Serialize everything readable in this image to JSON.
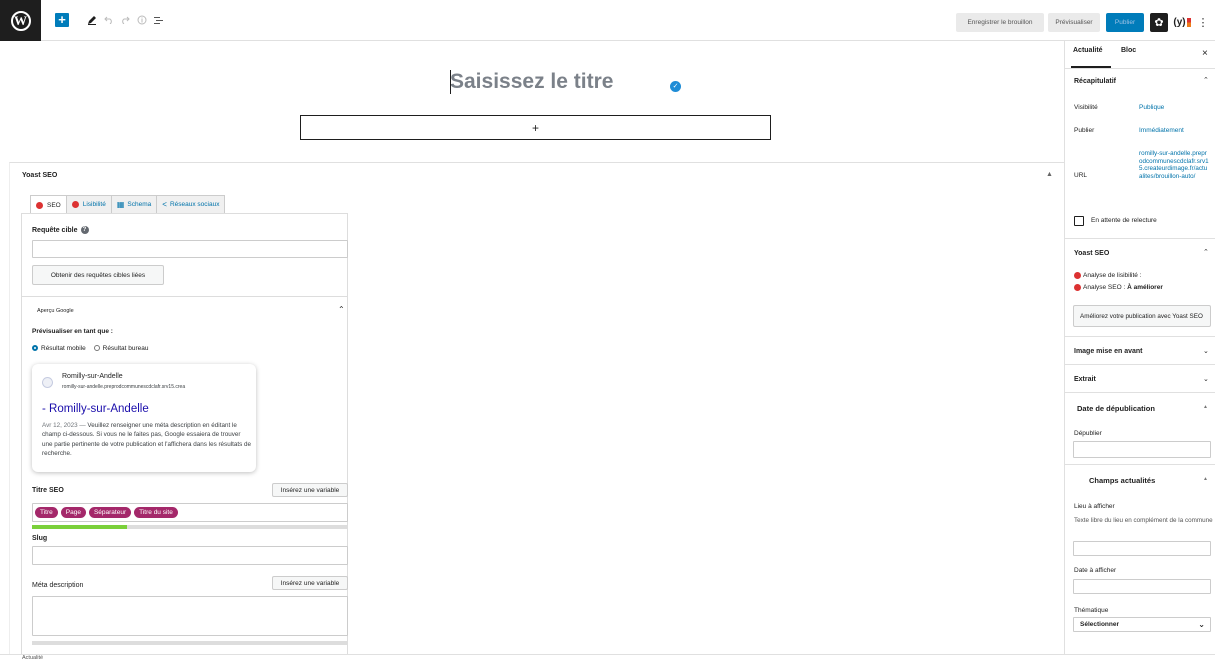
{
  "toolbar": {
    "wp_logo": "W",
    "add_glyph": "+",
    "save_draft": "Enregistrer le brouillon",
    "preview": "Prévisualiser",
    "publish": "Publier",
    "yoast_glyph": "(y)",
    "more_glyph": "⋮",
    "icons": [
      "wordpress-icon",
      "plus-icon",
      "pencil-icon",
      "undo-icon",
      "redo-icon",
      "info-icon",
      "list-view-icon",
      "gear-icon",
      "yoast-icon",
      "more-icon"
    ]
  },
  "editor": {
    "title_placeholder": "Saisissez le titre",
    "appender_glyph": "+"
  },
  "yoast": {
    "title": "Yoast SEO",
    "tabs": [
      {
        "label": "SEO",
        "icon": "red-dot-icon"
      },
      {
        "label": "Lisibilité",
        "icon": "red-dot-icon"
      },
      {
        "label": "Schema",
        "icon": "grid-icon"
      },
      {
        "label": "Réseaux sociaux",
        "icon": "share-icon"
      }
    ],
    "keyphrase_label": "Requête cible",
    "keyphrase_value": "",
    "related_button": "Obtenir des requêtes cibles liées",
    "google_preview_label": "Aperçu Google",
    "preview_as_label": "Prévisualiser en tant que :",
    "mode_mobile": "Résultat mobile",
    "mode_desktop": "Résultat bureau",
    "mode_selected": "mobile",
    "snippet": {
      "site_name": "Romilly-sur-Andelle",
      "site_url": "romilly-sur-andelle.preprodcommunescdclafr.srv15.crea",
      "title": "- Romilly-sur-Andelle",
      "date": "Avr 12, 2023",
      "dash": "—",
      "description": "Veuillez renseigner une méta description en éditant le champ ci-dessous. Si vous ne le faites pas, Google essaiera de trouver une partie pertinente de votre publication et l'affichera dans les résultats de recherche."
    },
    "seo_title_label": "Titre SEO",
    "insert_variable": "Insérez une variable",
    "title_pills": [
      "Titre",
      "Page",
      "Séparateur",
      "Titre du site"
    ],
    "title_progress": 0.3,
    "slug_label": "Slug",
    "slug_value": "",
    "meta_label": "Méta description",
    "meta_value": ""
  },
  "sidebar": {
    "tab_post": "Actualité",
    "tab_block": "Bloc",
    "close_glyph": "×",
    "summary_title": "Récapitulatif",
    "visibility_label": "Visibilité",
    "visibility_value": "Publique",
    "publish_label": "Publier",
    "publish_value": "Immédiatement",
    "url_label": "URL",
    "url_value": "romilly-sur-andelle.preprodcommunescdclafr.srv15.createurdimage.fr/actualites/brouillon-auto/",
    "pending_review": "En attente de relecture",
    "yoast_title": "Yoast SEO",
    "readability": "Analyse de lisibilité :",
    "seo_analysis": "Analyse SEO :",
    "seo_analysis_value": "À améliorer",
    "improve_button": "Améliorez votre publication avec Yoast SEO",
    "featured_image": "Image mise en avant",
    "excerpt": "Extrait",
    "unpublish_date_title": "Date de dépublication",
    "unpublish_label": "Dépublier",
    "news_fields_title": "Champs actualités",
    "location_label": "Lieu à afficher",
    "location_help": "Texte libre du lieu en complément de la commune",
    "date_display_label": "Date à afficher",
    "theme_label": "Thématique",
    "theme_select": "Sélectionner"
  },
  "footer": {
    "breadcrumb": "Actualité"
  }
}
